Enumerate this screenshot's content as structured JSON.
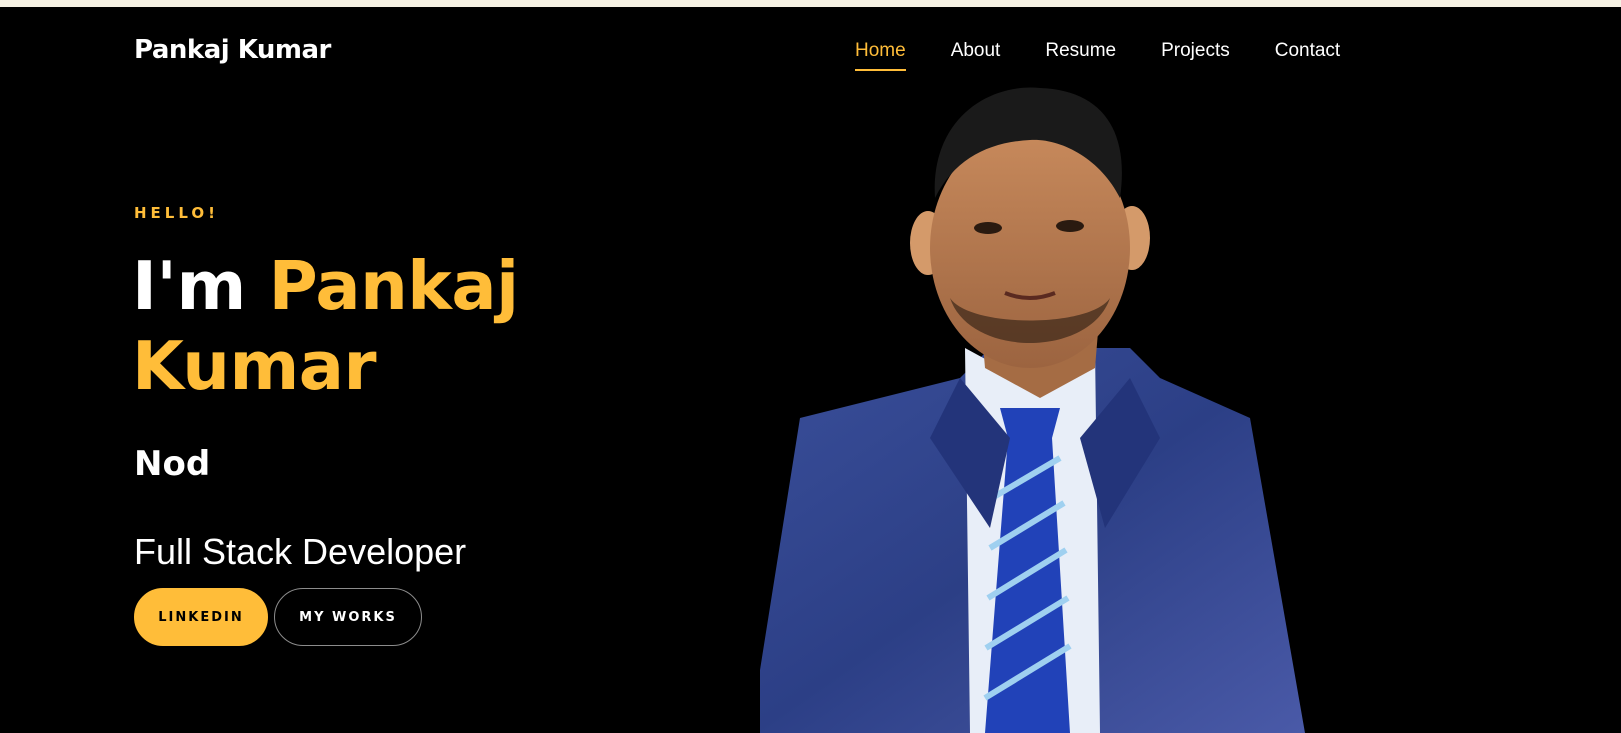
{
  "colors": {
    "background": "#000000",
    "accent": "#ffbd39",
    "text": "#ffffff",
    "top_strip": "#f6f2e4"
  },
  "navbar": {
    "brand": "Pankaj Kumar",
    "links": [
      {
        "label": "Home",
        "active": true
      },
      {
        "label": "About",
        "active": false
      },
      {
        "label": "Resume",
        "active": false
      },
      {
        "label": "Projects",
        "active": false
      },
      {
        "label": "Contact",
        "active": false
      }
    ]
  },
  "hero": {
    "greeting": "HELLO!",
    "headline_prefix": "I'm",
    "headline_name": "Pankaj Kumar",
    "subname": "Nod",
    "role": "Full Stack Developer",
    "buttons": {
      "linkedin": "LINKEDIN",
      "works": "MY WORKS"
    },
    "photo": "portrait-photo"
  }
}
